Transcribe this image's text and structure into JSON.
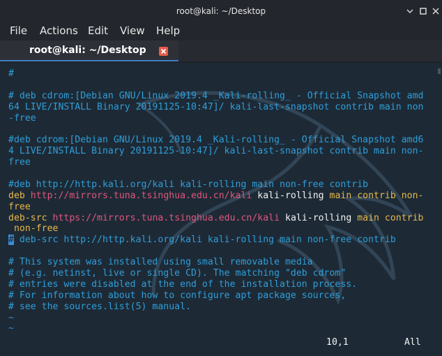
{
  "window": {
    "title": "root@kali: ~/Desktop"
  },
  "menu": {
    "file": "File",
    "actions": "Actions",
    "edit": "Edit",
    "view": "View",
    "help": "Help"
  },
  "tab": {
    "label": "root@kali: ~/Desktop"
  },
  "terminal": {
    "lines": [
      [
        {
          "t": "#",
          "c": "comment"
        }
      ],
      [],
      [
        {
          "t": "# deb cdrom:[Debian GNU/Linux 2019.4 _Kali-rolling_ - Official Snapshot amd",
          "c": "comment"
        }
      ],
      [
        {
          "t": "64 LIVE/INSTALL Binary 20191125-10:47]/ kali-last-snapshot contrib main non",
          "c": "comment"
        }
      ],
      [
        {
          "t": "-free",
          "c": "comment"
        }
      ],
      [],
      [
        {
          "t": "#deb cdrom:[Debian GNU/Linux 2019.4 _Kali-rolling_ - Official Snapshot amd6",
          "c": "comment"
        }
      ],
      [
        {
          "t": "4 LIVE/INSTALL Binary 20191125-10:47]/ kali-last-snapshot contrib main non-",
          "c": "comment"
        }
      ],
      [
        {
          "t": "free",
          "c": "comment"
        }
      ],
      [],
      [
        {
          "t": "#deb http://http.kali.org/kali kali-rolling main non-free contrib",
          "c": "comment"
        }
      ],
      [
        {
          "t": "deb ",
          "c": "key"
        },
        {
          "t": "http://mirrors.tuna.tsinghua.edu.cn/kali",
          "c": "url"
        },
        {
          "t": " kali-rolling ",
          "c": "white"
        },
        {
          "t": "main contrib non-",
          "c": "key"
        }
      ],
      [
        {
          "t": "free",
          "c": "key"
        }
      ],
      [
        {
          "t": "deb-src ",
          "c": "key"
        },
        {
          "t": "https://mirrors.tuna.tsinghua.edu.cn/kali",
          "c": "url"
        },
        {
          "t": " kali-rolling ",
          "c": "white"
        },
        {
          "t": "main contrib",
          "c": "key"
        }
      ],
      [
        {
          "t": " non-free",
          "c": "key"
        }
      ],
      [
        {
          "t": "#",
          "c": "cursor"
        },
        {
          "t": " deb-src http://http.kali.org/kali kali-rolling main non-free contrib",
          "c": "comment"
        }
      ],
      [],
      [
        {
          "t": "# This system was installed using small removable media",
          "c": "comment"
        }
      ],
      [
        {
          "t": "# (e.g. netinst, live or single CD). The matching \"deb cdrom\"",
          "c": "comment"
        }
      ],
      [
        {
          "t": "# entries were disabled at the end of the installation process.",
          "c": "comment"
        }
      ],
      [
        {
          "t": "# For information about how to configure apt package sources,",
          "c": "comment"
        }
      ],
      [
        {
          "t": "# see the sources.list(5) manual.",
          "c": "comment"
        }
      ],
      [
        {
          "t": "~",
          "c": "tilde"
        }
      ],
      [
        {
          "t": "~",
          "c": "tilde"
        }
      ]
    ],
    "status_position": "10,1",
    "status_scroll": "All"
  },
  "colors": {
    "comment": "#2f9ed8",
    "keyword": "#e8b84a",
    "url": "#e0557b",
    "text": "#f2f2f2",
    "background": "#1d2a36",
    "tab_close": "#e65b4a"
  },
  "icons": {
    "minimize": "chevron-down-icon",
    "maximize": "maximize-icon",
    "close": "close-icon",
    "tab_close": "close-icon",
    "background": "kali-dragon-icon"
  }
}
